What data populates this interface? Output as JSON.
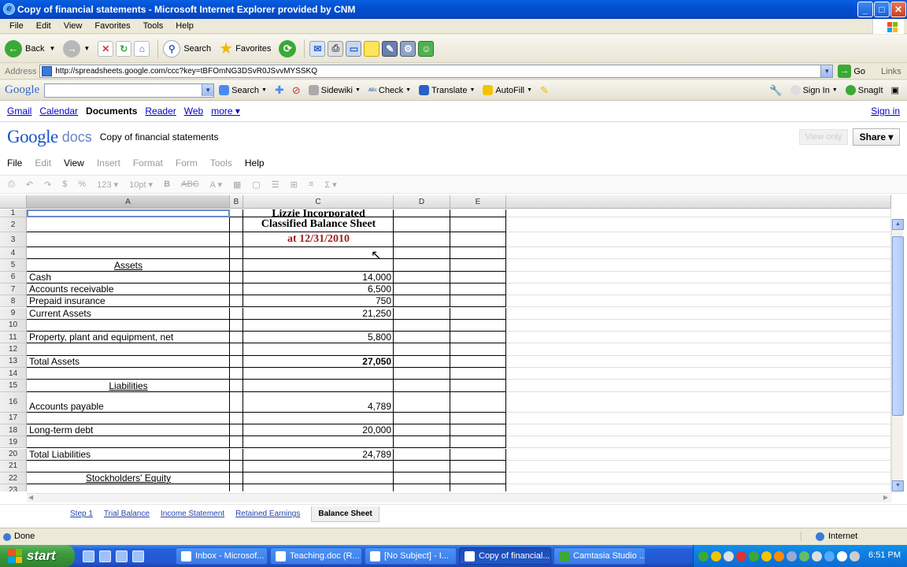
{
  "window": {
    "title": "Copy of financial statements - Microsoft Internet Explorer provided by CNM",
    "controls": {
      "minimize": "_",
      "maximize": "□",
      "close": "✕"
    }
  },
  "menu": [
    "File",
    "Edit",
    "View",
    "Favorites",
    "Tools",
    "Help"
  ],
  "toolbar": {
    "back": "Back",
    "search": "Search",
    "favorites": "Favorites"
  },
  "address": {
    "label": "Address",
    "url": "http://spreadsheets.google.com/ccc?key=tBFOmNG3DSvR0JSvvMYSSKQ",
    "go": "Go",
    "links": "Links"
  },
  "google_toolbar": {
    "logo": "Google",
    "items": [
      "Search",
      "Sidewiki",
      "Check",
      "Translate",
      "AutoFill"
    ],
    "sign_in": "Sign In",
    "snagit": "SnagIt"
  },
  "gbar": {
    "links": [
      "Gmail",
      "Calendar"
    ],
    "current": "Documents",
    "links2": [
      "Reader",
      "Web"
    ],
    "more": "more ▾",
    "sign_in": "Sign in"
  },
  "doc": {
    "logo_google": "Google",
    "logo_docs": "docs",
    "title": "Copy of financial statements",
    "view_only": "View only",
    "share": "Share ▾"
  },
  "sheet_menu": [
    {
      "label": "File",
      "enabled": true
    },
    {
      "label": "Edit",
      "enabled": false
    },
    {
      "label": "View",
      "enabled": true
    },
    {
      "label": "Insert",
      "enabled": false
    },
    {
      "label": "Format",
      "enabled": false
    },
    {
      "label": "Form",
      "enabled": false
    },
    {
      "label": "Tools",
      "enabled": false
    },
    {
      "label": "Help",
      "enabled": true
    }
  ],
  "format_bar": [
    "$",
    "%",
    "123 ▾",
    "10pt ▾",
    "B",
    "ABC",
    "A ▾",
    "Σ ▾"
  ],
  "columns": [
    "A",
    "B",
    "C",
    "D",
    "E"
  ],
  "rows": [
    {
      "n": "1",
      "a": "",
      "c": "Lizzie Incorporated"
    },
    {
      "n": "2",
      "a": "",
      "c": "Classified Balance Sheet"
    },
    {
      "n": "3",
      "a": "",
      "c": "at 12/31/2010"
    },
    {
      "n": "4",
      "a": "",
      "c": ""
    },
    {
      "n": "5",
      "a": "Assets",
      "c": ""
    },
    {
      "n": "6",
      "a": "Cash",
      "c": "14,000"
    },
    {
      "n": "7",
      "a": "Accounts receivable",
      "c": "6,500"
    },
    {
      "n": "8",
      "a": "Prepaid insurance",
      "c": "750"
    },
    {
      "n": "9",
      "a": "Current Assets",
      "c": "21,250"
    },
    {
      "n": "10",
      "a": "",
      "c": ""
    },
    {
      "n": "11",
      "a": "Property, plant and equipment, net",
      "c": "5,800"
    },
    {
      "n": "12",
      "a": "",
      "c": ""
    },
    {
      "n": "13",
      "a": "Total Assets",
      "c": "27,050"
    },
    {
      "n": "14",
      "a": "",
      "c": ""
    },
    {
      "n": "15",
      "a": "Liabilities",
      "c": ""
    },
    {
      "n": "16",
      "a": "Accounts payable",
      "c": "4,789"
    },
    {
      "n": "17",
      "a": "",
      "c": ""
    },
    {
      "n": "18",
      "a": "Long-term debt",
      "c": "20,000"
    },
    {
      "n": "19",
      "a": "",
      "c": ""
    },
    {
      "n": "20",
      "a": "Total Liabilities",
      "c": "24,789"
    },
    {
      "n": "21",
      "a": "",
      "c": ""
    },
    {
      "n": "22",
      "a": "Stockholders' Equity",
      "c": ""
    },
    {
      "n": "23",
      "a": "",
      "c": ""
    }
  ],
  "sheet_tabs": [
    "Step 1",
    "Trial Balance",
    "Income Statement",
    "Retained Earnings",
    "Balance Sheet"
  ],
  "active_tab": "Balance Sheet",
  "status": {
    "left": "Done",
    "zone": "Internet"
  },
  "taskbar": {
    "start": "start",
    "tasks": [
      "Inbox - Microsof...",
      "Teaching.doc (R...",
      "[No Subject] - I...",
      "Copy of financial...",
      "Camtasia Studio ..."
    ],
    "active_task": "Copy of financial...",
    "clock": "6:51 PM"
  },
  "colors": {
    "accent_red": "#a41d1d",
    "link": "#0000cc",
    "xp_blue": "#0a5fe0"
  }
}
